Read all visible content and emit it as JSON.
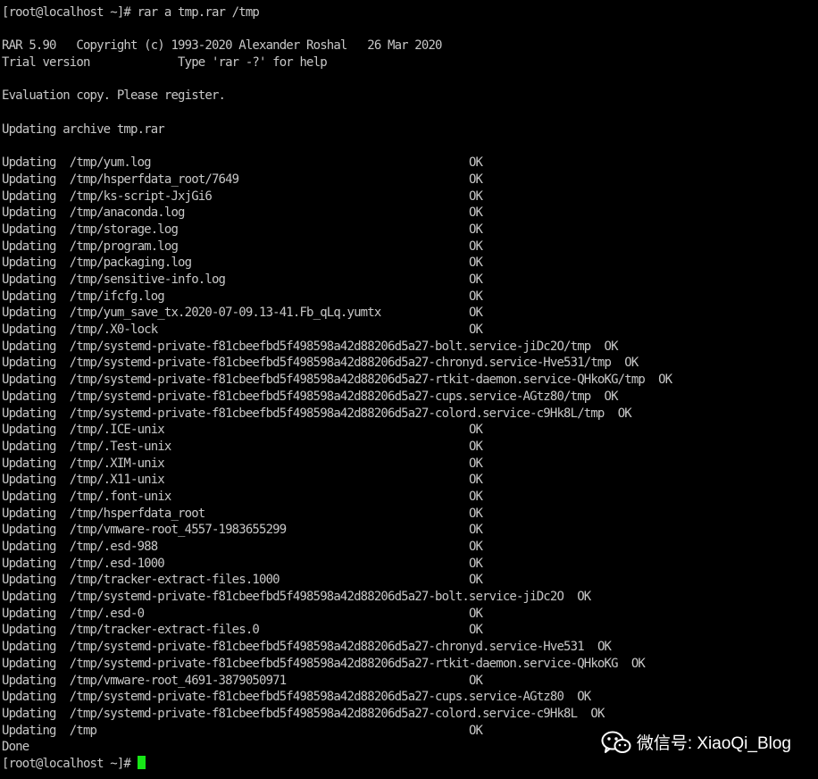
{
  "terminal": {
    "command_line": "[root@localhost ~]# rar a tmp.rar /tmp",
    "header_line1": "RAR 5.90   Copyright (c) 1993-2020 Alexander Roshal   26 Mar 2020",
    "header_line2": "Trial version             Type 'rar -?' for help",
    "eval_line": "Evaluation copy. Please register.",
    "archive_line": "Updating archive tmp.rar",
    "updates": [
      {
        "label": "Updating  /tmp/yum.log",
        "pad": 69,
        "status": "OK"
      },
      {
        "label": "Updating  /tmp/hsperfdata_root/7649",
        "pad": 69,
        "status": "OK"
      },
      {
        "label": "Updating  /tmp/ks-script-JxjGi6",
        "pad": 69,
        "status": "OK"
      },
      {
        "label": "Updating  /tmp/anaconda.log",
        "pad": 69,
        "status": "OK"
      },
      {
        "label": "Updating  /tmp/storage.log",
        "pad": 69,
        "status": "OK"
      },
      {
        "label": "Updating  /tmp/program.log",
        "pad": 69,
        "status": "OK"
      },
      {
        "label": "Updating  /tmp/packaging.log",
        "pad": 69,
        "status": "OK"
      },
      {
        "label": "Updating  /tmp/sensitive-info.log",
        "pad": 69,
        "status": "OK"
      },
      {
        "label": "Updating  /tmp/ifcfg.log",
        "pad": 69,
        "status": "OK"
      },
      {
        "label": "Updating  /tmp/yum_save_tx.2020-07-09.13-41.Fb_qLq.yumtx",
        "pad": 69,
        "status": "OK"
      },
      {
        "label": "Updating  /tmp/.X0-lock",
        "pad": 69,
        "status": "OK"
      },
      {
        "label": "Updating  /tmp/systemd-private-f81cbeefbd5f498598a42d88206d5a27-bolt.service-jiDc2O/tmp",
        "pad": 0,
        "status": "OK"
      },
      {
        "label": "Updating  /tmp/systemd-private-f81cbeefbd5f498598a42d88206d5a27-chronyd.service-Hve531/tmp",
        "pad": 0,
        "status": "OK"
      },
      {
        "label": "Updating  /tmp/systemd-private-f81cbeefbd5f498598a42d88206d5a27-rtkit-daemon.service-QHkoKG/tmp",
        "pad": 0,
        "status": "OK"
      },
      {
        "label": "Updating  /tmp/systemd-private-f81cbeefbd5f498598a42d88206d5a27-cups.service-AGtz80/tmp",
        "pad": 0,
        "status": "OK"
      },
      {
        "label": "Updating  /tmp/systemd-private-f81cbeefbd5f498598a42d88206d5a27-colord.service-c9Hk8L/tmp",
        "pad": 0,
        "status": "OK"
      },
      {
        "label": "Updating  /tmp/.ICE-unix",
        "pad": 69,
        "status": "OK"
      },
      {
        "label": "Updating  /tmp/.Test-unix",
        "pad": 69,
        "status": "OK"
      },
      {
        "label": "Updating  /tmp/.XIM-unix",
        "pad": 69,
        "status": "OK"
      },
      {
        "label": "Updating  /tmp/.X11-unix",
        "pad": 69,
        "status": "OK"
      },
      {
        "label": "Updating  /tmp/.font-unix",
        "pad": 69,
        "status": "OK"
      },
      {
        "label": "Updating  /tmp/hsperfdata_root",
        "pad": 69,
        "status": "OK"
      },
      {
        "label": "Updating  /tmp/vmware-root_4557-1983655299",
        "pad": 69,
        "status": "OK"
      },
      {
        "label": "Updating  /tmp/.esd-988",
        "pad": 69,
        "status": "OK"
      },
      {
        "label": "Updating  /tmp/.esd-1000",
        "pad": 69,
        "status": "OK"
      },
      {
        "label": "Updating  /tmp/tracker-extract-files.1000",
        "pad": 69,
        "status": "OK"
      },
      {
        "label": "Updating  /tmp/systemd-private-f81cbeefbd5f498598a42d88206d5a27-bolt.service-jiDc2O",
        "pad": 0,
        "status": "OK"
      },
      {
        "label": "Updating  /tmp/.esd-0",
        "pad": 69,
        "status": "OK"
      },
      {
        "label": "Updating  /tmp/tracker-extract-files.0",
        "pad": 69,
        "status": "OK"
      },
      {
        "label": "Updating  /tmp/systemd-private-f81cbeefbd5f498598a42d88206d5a27-chronyd.service-Hve531",
        "pad": 0,
        "status": "OK"
      },
      {
        "label": "Updating  /tmp/systemd-private-f81cbeefbd5f498598a42d88206d5a27-rtkit-daemon.service-QHkoKG",
        "pad": 0,
        "status": "OK"
      },
      {
        "label": "Updating  /tmp/vmware-root_4691-3879050971",
        "pad": 69,
        "status": "OK"
      },
      {
        "label": "Updating  /tmp/systemd-private-f81cbeefbd5f498598a42d88206d5a27-cups.service-AGtz80",
        "pad": 0,
        "status": "OK"
      },
      {
        "label": "Updating  /tmp/systemd-private-f81cbeefbd5f498598a42d88206d5a27-colord.service-c9Hk8L",
        "pad": 0,
        "status": "OK"
      },
      {
        "label": "Updating  /tmp",
        "pad": 69,
        "status": "OK"
      }
    ],
    "done_line": "Done",
    "prompt": "[root@localhost ~]# ",
    "cursor_color": "#17e617",
    "text_color": "#c7c7c7",
    "background_color": "#000000"
  },
  "watermark": {
    "icon": "wechat-icon",
    "text": "微信号: XiaoQi_Blog"
  }
}
